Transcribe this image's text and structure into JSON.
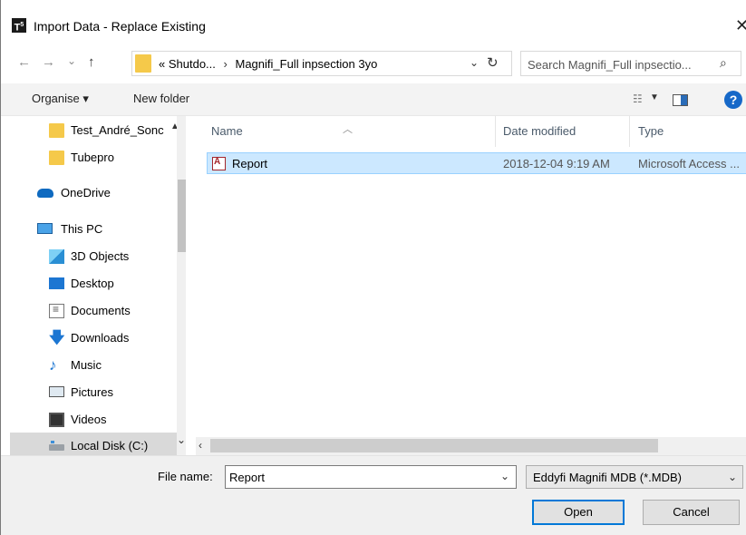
{
  "window": {
    "title": "Import Data - Replace Existing",
    "app_icon_text": "T",
    "app_icon_sup": "5",
    "close_glyph": "✕"
  },
  "address": {
    "overflow": "«",
    "crumbs": [
      "Shutdo...",
      "Magnifi_Full inpsection 3yo"
    ],
    "separator": "›",
    "dropdown_glyph": "⌄",
    "refresh_glyph": "↻"
  },
  "search": {
    "placeholder": "Search Magnifi_Full inpsectio...",
    "icon": "search-icon"
  },
  "nav_buttons": {
    "back": "←",
    "forward": "→",
    "recent": "⌄",
    "up": "↑"
  },
  "toolbar": {
    "organise_label": "Organise ▾",
    "new_folder_label": "New folder",
    "help_label": "?"
  },
  "navpane": {
    "items": [
      {
        "label": "Test_André_Sonc",
        "icon": "folder-icon"
      },
      {
        "label": "Tubepro",
        "icon": "folder-icon"
      },
      {
        "label": "OneDrive",
        "icon": "onedrive-icon"
      },
      {
        "label": "This PC",
        "icon": "pc-icon"
      },
      {
        "label": "3D Objects",
        "icon": "3d-objects-icon"
      },
      {
        "label": "Desktop",
        "icon": "desktop-icon"
      },
      {
        "label": "Documents",
        "icon": "documents-icon"
      },
      {
        "label": "Downloads",
        "icon": "downloads-icon"
      },
      {
        "label": "Music",
        "icon": "music-icon"
      },
      {
        "label": "Pictures",
        "icon": "pictures-icon"
      },
      {
        "label": "Videos",
        "icon": "videos-icon"
      },
      {
        "label": "Local Disk (C:)",
        "icon": "local-disk-icon"
      }
    ]
  },
  "filelist": {
    "columns": [
      "Name",
      "Date modified",
      "Type"
    ],
    "rows": [
      {
        "name": "Report",
        "date": "2018-12-04 9:19 AM",
        "type": "Microsoft Access ..."
      }
    ]
  },
  "footer": {
    "file_name_label": "File name:",
    "file_name_value": "Report",
    "file_type": "Eddyfi Magnifi MDB (*.MDB)",
    "open_label": "Open",
    "cancel_label": "Cancel"
  },
  "colors": {
    "selection_bg": "#cce8ff",
    "selection_border": "#99d1ff",
    "accent": "#0078d7",
    "folder": "#f5c94a"
  }
}
